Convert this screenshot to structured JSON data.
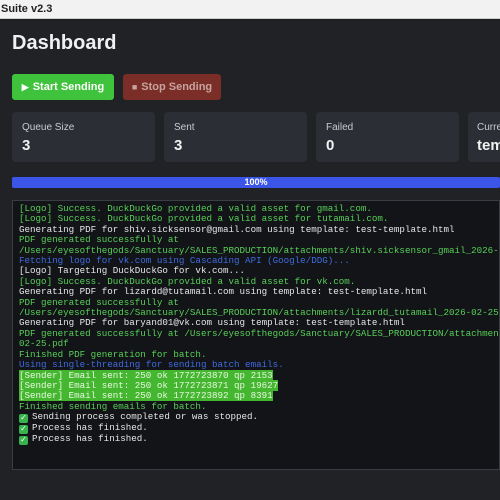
{
  "window": {
    "title": "Suite v2.3"
  },
  "page": {
    "title": "Dashboard"
  },
  "buttons": {
    "start": "Start Sending",
    "stop": "Stop Sending"
  },
  "stats": [
    {
      "label": "Queue Size",
      "value": "3"
    },
    {
      "label": "Sent",
      "value": "3"
    },
    {
      "label": "Failed",
      "value": "0"
    },
    {
      "label": "Curre",
      "value": "tem"
    }
  ],
  "progress": {
    "label": "100%",
    "fraction": 1.0
  },
  "log": [
    {
      "style": "green",
      "text": "[Logo] Success. DuckDuckGo provided a valid asset for gmail.com."
    },
    {
      "style": "green",
      "text": "[Logo] Success. DuckDuckGo provided a valid asset for tutamail.com."
    },
    {
      "style": "white",
      "text": "Generating PDF for shiv.sicksensor@gmail.com using template: test-template.html"
    },
    {
      "style": "green",
      "text": "PDF generated successfully at"
    },
    {
      "style": "green",
      "text": "/Users/eyesofthegods/Sanctuary/SALES_PRODUCTION/attachments/shiv.sicksensor_gmail_2026-02-"
    },
    {
      "style": "blue",
      "text": "Fetching logo for vk.com using Cascading API (Google/DDG)..."
    },
    {
      "style": "white",
      "text": "[Logo] Targeting DuckDuckGo for vk.com..."
    },
    {
      "style": "green",
      "text": "[Logo] Success. DuckDuckGo provided a valid asset for vk.com."
    },
    {
      "style": "white",
      "text": "Generating PDF for lizardd@tutamail.com using template: test-template.html"
    },
    {
      "style": "green",
      "text": "PDF generated successfully at"
    },
    {
      "style": "green",
      "text": "/Users/eyesofthegods/Sanctuary/SALES_PRODUCTION/attachments/lizardd_tutamail_2026-02-25.pd"
    },
    {
      "style": "white",
      "text": "Generating PDF for baryand01@vk.com using template: test-template.html"
    },
    {
      "style": "green",
      "text": "PDF generated successfully at /Users/eyesofthegods/Sanctuary/SALES_PRODUCTION/attachments"
    },
    {
      "style": "green",
      "text": "02-25.pdf"
    },
    {
      "style": "green",
      "text": "Finished PDF generation for batch."
    },
    {
      "style": "blue",
      "text": "Using single-threading for sending batch emails."
    },
    {
      "style": "hl",
      "text": "[Sender] Email sent: 250 ok 1772723870 qp 2153"
    },
    {
      "style": "hl",
      "text": "[Sender] Email sent: 250 ok 1772723871 qp 19627"
    },
    {
      "style": "hl",
      "text": "[Sender] Email sent: 250 ok 1772723892 qp 8391"
    },
    {
      "style": "green",
      "text": "Finished sending emails for batch."
    },
    {
      "style": "check",
      "text": "Sending process completed or was stopped."
    },
    {
      "style": "check",
      "text": "Process has finished."
    },
    {
      "style": "check",
      "text": "Process has finished."
    }
  ],
  "colors": {
    "accent": "#3fc23c",
    "progress": "#3a55e8",
    "log_green": "#58cf58",
    "log_blue": "#3f6be0"
  }
}
